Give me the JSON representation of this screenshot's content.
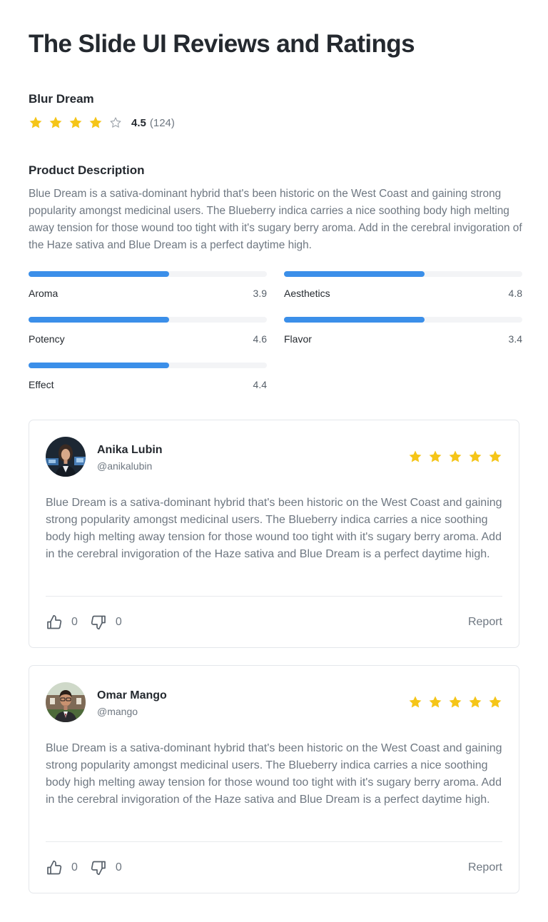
{
  "page": {
    "title": "The Slide UI Reviews and Ratings"
  },
  "product": {
    "name": "Blur Dream",
    "rating": 4.5,
    "rating_text": "4.5",
    "review_count_text": "(124)",
    "stars": [
      "filled",
      "filled",
      "filled",
      "filled",
      "empty"
    ],
    "star_color": "#f5c518",
    "empty_star_color": "#9aa1a9"
  },
  "description": {
    "heading": "Product Description",
    "text": "Blue Dream is a sativa-dominant hybrid that's been historic on the West Coast and gaining strong popularity amongst medicinal users. The Blueberry indica carries a nice soothing body high melting away tension for those wound too tight with it's sugary berry aroma. Add in the cerebral invigoration of the Haze sativa and Blue Dream is a perfect daytime high."
  },
  "metrics": [
    {
      "label": "Aroma",
      "value": "3.9",
      "fill_fraction": 0.59
    },
    {
      "label": "Aesthetics",
      "value": "4.8",
      "fill_fraction": 0.59
    },
    {
      "label": "Potency",
      "value": "4.6",
      "fill_fraction": 0.59
    },
    {
      "label": "Flavor",
      "value": "3.4",
      "fill_fraction": 0.59
    },
    {
      "label": "Effect",
      "value": "4.4",
      "fill_fraction": 0.59
    }
  ],
  "metric_bar_color": "#3b8fe9",
  "reviews": [
    {
      "name": "Anika Lubin",
      "handle": "@anikalubin",
      "stars": 5,
      "text": "Blue Dream is a sativa-dominant hybrid that's been historic on the West Coast and gaining strong popularity amongst medicinal users. The Blueberry indica carries a nice soothing body high melting away tension for those wound too tight with it's sugary berry aroma. Add in the cerebral invigoration of the Haze sativa and Blue Dream is a perfect daytime high.",
      "likes": "0",
      "dislikes": "0",
      "report_label": "Report"
    },
    {
      "name": "Omar Mango",
      "handle": "@mango",
      "stars": 5,
      "text": "Blue Dream is a sativa-dominant hybrid that's been historic on the West Coast and gaining strong popularity amongst medicinal users. The Blueberry indica carries a nice soothing body high melting away tension for those wound too tight with it's sugary berry aroma. Add in the cerebral invigoration of the Haze sativa and Blue Dream is a perfect daytime high.",
      "likes": "0",
      "dislikes": "0",
      "report_label": "Report"
    }
  ],
  "icons": {
    "star": "star-icon",
    "like": "thumbs-up-icon",
    "dislike": "thumbs-down-icon"
  }
}
